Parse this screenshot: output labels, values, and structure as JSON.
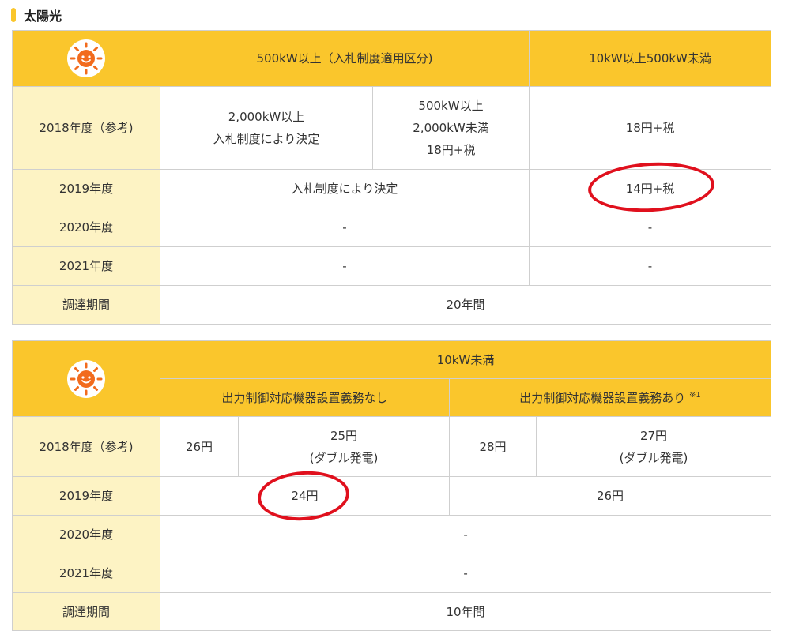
{
  "section": {
    "title": "太陽光",
    "accent": "#fac62c"
  },
  "table1": {
    "header_a": "500kW以上（入札制度適用区分)",
    "header_b": "10kW以上500kW未満",
    "rows": {
      "r2018": {
        "label": "2018年度（参考)",
        "c1": [
          "2,000kW以上",
          "入札制度により決定"
        ],
        "c2": [
          "500kW以上",
          "2,000kW未満",
          "18円+税"
        ],
        "c3": "18円+税"
      },
      "r2019": {
        "label": "2019年度",
        "c1": "入札制度により決定",
        "c2": "14円+税"
      },
      "r2020": {
        "label": "2020年度",
        "c1": "-",
        "c2": "-"
      },
      "r2021": {
        "label": "2021年度",
        "c1": "-",
        "c2": "-"
      },
      "period": {
        "label": "調達期間",
        "value": "20年間"
      }
    }
  },
  "table2": {
    "header_top": "10kW未満",
    "header_a": "出力制御対応機器設置義務なし",
    "header_b": "出力制御対応機器設置義務あり",
    "header_b_note": "※1",
    "rows": {
      "r2018": {
        "label": "2018年度（参考)",
        "c1": "26円",
        "c2": [
          "25円",
          "(ダブル発電)"
        ],
        "c3": "28円",
        "c4": [
          "27円",
          "(ダブル発電)"
        ]
      },
      "r2019": {
        "label": "2019年度",
        "c1": "24円",
        "c2": "26円"
      },
      "r2020": {
        "label": "2020年度",
        "value": "-"
      },
      "r2021": {
        "label": "2021年度",
        "value": "-"
      },
      "period": {
        "label": "調達期間",
        "value": "10年間"
      }
    }
  },
  "colors": {
    "header": "#fac62c",
    "label_bg": "#fdf3c4",
    "border": "#cfcfcf",
    "highlight": "#e0101d",
    "sun": "#f26b1d"
  },
  "icons": [
    "sun-icon"
  ]
}
